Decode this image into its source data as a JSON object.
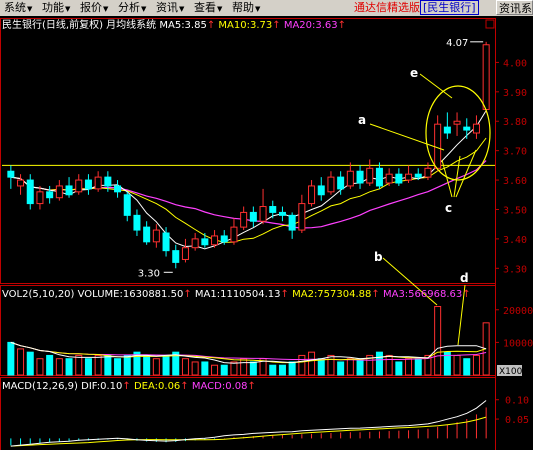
{
  "menu": {
    "items": [
      {
        "label": "系统"
      },
      {
        "label": "功能"
      },
      {
        "label": "报价"
      },
      {
        "label": "分析"
      },
      {
        "label": "资讯"
      },
      {
        "label": "查看"
      },
      {
        "label": "帮助"
      }
    ],
    "arrow": "▼",
    "promo_red": "通达信精选版",
    "promo_blue": "[民生银行]",
    "promo_button": "资讯系"
  },
  "colors": {
    "up": "#ff3030",
    "down": "#00ffff",
    "ma5": "#ffffff",
    "ma10": "#ffff00",
    "ma20": "#ff40ff",
    "hline": "#ffff00",
    "annotation": "#ffff00"
  },
  "price_panel": {
    "title": "民生银行(日线,前复权) 月均线系统",
    "ma5": "MA5:3.85",
    "ma10": "MA10:3.73",
    "ma20": "MA20:3.63",
    "arrow_up": "↑",
    "high_label": "4.07",
    "low_label": "3.30",
    "annotations": [
      "a",
      "b",
      "c",
      "d",
      "e"
    ]
  },
  "volume_panel": {
    "title": "VOL2(5,10,20) VOLUME:1630881.50",
    "ma1": "MA1:1110504.13",
    "ma2": "MA2:757304.88",
    "ma3": "MA3:566968.63",
    "multiplier": "X100"
  },
  "macd_panel": {
    "title": "MACD(12,26,9) DIF:0.10",
    "dea": "DEA:0.06",
    "macd": "MACD:0.08"
  },
  "chart_data": {
    "type": "candlestick",
    "price_axis": {
      "ticks": [
        3.3,
        3.4,
        3.5,
        3.6,
        3.7,
        3.8,
        3.9,
        4.0
      ],
      "labels": [
        "3.30",
        "3.40",
        "3.50",
        "3.60",
        "3.70",
        "3.80",
        "3.90",
        "4.00"
      ],
      "range": [
        3.25,
        4.1
      ]
    },
    "volume_axis": {
      "ticks": [
        10000,
        20000
      ],
      "labels": [
        "10000",
        "20000"
      ],
      "range": [
        0,
        23000
      ]
    },
    "macd_axis": {
      "ticks": [
        0.05,
        0.1
      ],
      "labels": [
        "0.05",
        "0.10"
      ],
      "range": [
        -0.03,
        0.12
      ]
    },
    "horizontal_line": 3.65,
    "candles": [
      {
        "o": 3.63,
        "c": 3.61,
        "h": 3.65,
        "l": 3.57
      },
      {
        "o": 3.58,
        "c": 3.6,
        "h": 3.62,
        "l": 3.55
      },
      {
        "o": 3.6,
        "c": 3.52,
        "h": 3.62,
        "l": 3.5
      },
      {
        "o": 3.52,
        "c": 3.56,
        "h": 3.58,
        "l": 3.5
      },
      {
        "o": 3.56,
        "c": 3.54,
        "h": 3.58,
        "l": 3.52
      },
      {
        "o": 3.54,
        "c": 3.58,
        "h": 3.6,
        "l": 3.53
      },
      {
        "o": 3.58,
        "c": 3.55,
        "h": 3.61,
        "l": 3.54
      },
      {
        "o": 3.56,
        "c": 3.6,
        "h": 3.62,
        "l": 3.55
      },
      {
        "o": 3.6,
        "c": 3.57,
        "h": 3.62,
        "l": 3.55
      },
      {
        "o": 3.57,
        "c": 3.61,
        "h": 3.63,
        "l": 3.56
      },
      {
        "o": 3.61,
        "c": 3.58,
        "h": 3.63,
        "l": 3.56
      },
      {
        "o": 3.58,
        "c": 3.56,
        "h": 3.6,
        "l": 3.54
      },
      {
        "o": 3.55,
        "c": 3.48,
        "h": 3.56,
        "l": 3.46
      },
      {
        "o": 3.48,
        "c": 3.43,
        "h": 3.5,
        "l": 3.41
      },
      {
        "o": 3.44,
        "c": 3.39,
        "h": 3.46,
        "l": 3.38
      },
      {
        "o": 3.39,
        "c": 3.43,
        "h": 3.45,
        "l": 3.37
      },
      {
        "o": 3.42,
        "c": 3.36,
        "h": 3.44,
        "l": 3.34
      },
      {
        "o": 3.36,
        "c": 3.32,
        "h": 3.38,
        "l": 3.3
      },
      {
        "o": 3.33,
        "c": 3.37,
        "h": 3.4,
        "l": 3.32
      },
      {
        "o": 3.37,
        "c": 3.4,
        "h": 3.42,
        "l": 3.36
      },
      {
        "o": 3.4,
        "c": 3.38,
        "h": 3.42,
        "l": 3.37
      },
      {
        "o": 3.38,
        "c": 3.41,
        "h": 3.43,
        "l": 3.37
      },
      {
        "o": 3.41,
        "c": 3.39,
        "h": 3.43,
        "l": 3.38
      },
      {
        "o": 3.39,
        "c": 3.44,
        "h": 3.47,
        "l": 3.38
      },
      {
        "o": 3.44,
        "c": 3.49,
        "h": 3.51,
        "l": 3.43
      },
      {
        "o": 3.49,
        "c": 3.46,
        "h": 3.51,
        "l": 3.44
      },
      {
        "o": 3.46,
        "c": 3.51,
        "h": 3.57,
        "l": 3.45
      },
      {
        "o": 3.51,
        "c": 3.49,
        "h": 3.53,
        "l": 3.47
      },
      {
        "o": 3.49,
        "c": 3.48,
        "h": 3.51,
        "l": 3.46
      },
      {
        "o": 3.48,
        "c": 3.43,
        "h": 3.49,
        "l": 3.4
      },
      {
        "o": 3.43,
        "c": 3.52,
        "h": 3.55,
        "l": 3.42
      },
      {
        "o": 3.52,
        "c": 3.58,
        "h": 3.6,
        "l": 3.51
      },
      {
        "o": 3.58,
        "c": 3.55,
        "h": 3.61,
        "l": 3.53
      },
      {
        "o": 3.56,
        "c": 3.61,
        "h": 3.63,
        "l": 3.55
      },
      {
        "o": 3.61,
        "c": 3.57,
        "h": 3.63,
        "l": 3.55
      },
      {
        "o": 3.58,
        "c": 3.63,
        "h": 3.66,
        "l": 3.57
      },
      {
        "o": 3.63,
        "c": 3.59,
        "h": 3.65,
        "l": 3.57
      },
      {
        "o": 3.59,
        "c": 3.64,
        "h": 3.67,
        "l": 3.58
      },
      {
        "o": 3.64,
        "c": 3.58,
        "h": 3.66,
        "l": 3.57
      },
      {
        "o": 3.59,
        "c": 3.62,
        "h": 3.64,
        "l": 3.58
      },
      {
        "o": 3.62,
        "c": 3.59,
        "h": 3.64,
        "l": 3.58
      },
      {
        "o": 3.6,
        "c": 3.62,
        "h": 3.65,
        "l": 3.59
      },
      {
        "o": 3.62,
        "c": 3.61,
        "h": 3.64,
        "l": 3.6
      },
      {
        "o": 3.61,
        "c": 3.64,
        "h": 3.66,
        "l": 3.6
      },
      {
        "o": 3.64,
        "c": 3.79,
        "h": 3.82,
        "l": 3.63
      },
      {
        "o": 3.78,
        "c": 3.76,
        "h": 3.83,
        "l": 3.74
      },
      {
        "o": 3.79,
        "c": 3.8,
        "h": 3.83,
        "l": 3.75
      },
      {
        "o": 3.78,
        "c": 3.77,
        "h": 3.81,
        "l": 3.74
      },
      {
        "o": 3.76,
        "c": 3.79,
        "h": 3.82,
        "l": 3.74
      },
      {
        "o": 3.84,
        "c": 4.06,
        "h": 4.07,
        "l": 3.83
      }
    ],
    "volume": [
      10,
      8,
      7,
      5,
      6,
      5,
      5,
      6,
      5,
      6,
      6,
      5,
      6,
      7,
      6,
      5,
      6,
      7,
      5,
      4,
      4,
      3,
      3,
      4,
      5,
      4,
      5,
      3,
      3,
      4,
      6,
      7,
      5,
      6,
      4,
      5,
      5,
      6,
      7,
      6,
      4,
      5,
      5,
      6,
      21,
      7,
      6,
      5,
      6,
      16
    ],
    "macd_hist": [
      -0.018,
      -0.016,
      -0.014,
      -0.012,
      -0.01,
      -0.009,
      -0.008,
      -0.006,
      -0.005,
      -0.004,
      -0.003,
      -0.002,
      -0.004,
      -0.006,
      -0.008,
      -0.009,
      -0.01,
      -0.009,
      -0.007,
      -0.005,
      -0.004,
      -0.002,
      0.001,
      0.003,
      0.004,
      0.006,
      0.007,
      0.008,
      0.009,
      0.009,
      0.011,
      0.012,
      0.013,
      0.014,
      0.015,
      0.016,
      0.016,
      0.017,
      0.018,
      0.019,
      0.02,
      0.021,
      0.023,
      0.025,
      0.03,
      0.036,
      0.042,
      0.05,
      0.062,
      0.08
    ]
  }
}
